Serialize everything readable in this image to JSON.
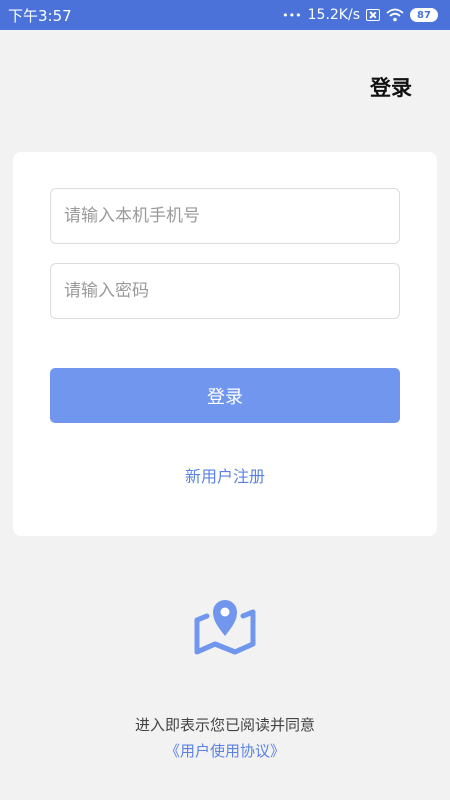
{
  "status_bar": {
    "time": "下午3:57",
    "dots": "•••",
    "speed": "15.2K/s",
    "battery": "87"
  },
  "header": {
    "title": "登录"
  },
  "form": {
    "phone_placeholder": "请输入本机手机号",
    "password_placeholder": "请输入密码",
    "login_label": "登录",
    "register_label": "新用户注册"
  },
  "footer": {
    "agree_text": "进入即表示您已阅读并同意",
    "agreement_link": "《用户使用协议》"
  },
  "colors": {
    "status_bar": "#4a72d8",
    "primary_button": "#7196ee",
    "link": "#5b82e2",
    "background": "#f2f2f2"
  },
  "icons": [
    "sim-off-icon",
    "wifi-icon",
    "battery-icon",
    "map-location-icon"
  ]
}
